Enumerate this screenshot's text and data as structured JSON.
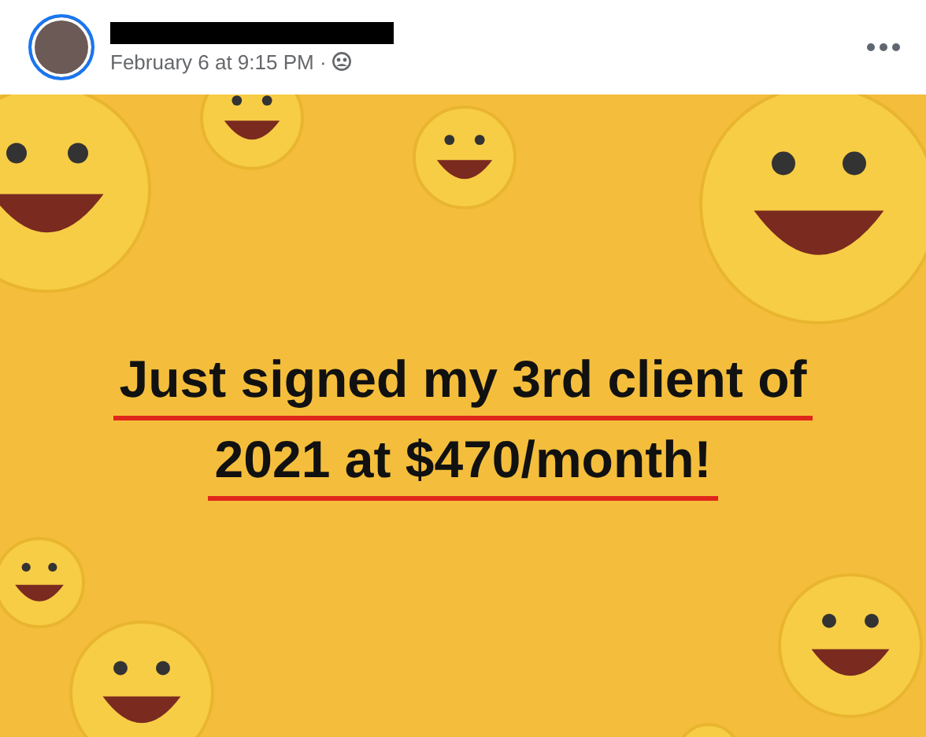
{
  "post": {
    "timestamp": "February 6 at 9:15 PM ·",
    "image_text_lines": [
      "Just signed my 3rd client of",
      "2021 at $470/month!"
    ]
  }
}
